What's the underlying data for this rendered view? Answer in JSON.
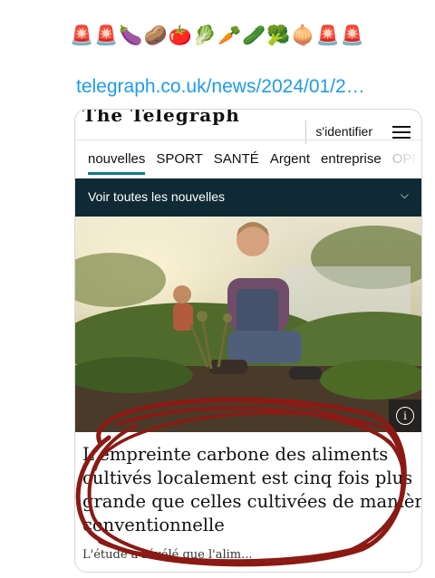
{
  "tweet": {
    "emoji_line": "🚨🚨🍆🥔🍅🥬🥕🥒🥦🧅🚨🚨",
    "link_text": "telegraph.co.uk/news/2024/01/2…"
  },
  "card": {
    "masthead": "The Telegraph",
    "signin_label": "s'identifier",
    "nav_tabs": [
      "nouvelles",
      "SPORT",
      "SANTÉ",
      "Argent",
      "entreprise",
      "OPI"
    ],
    "drawer_label": "Voir toutes les nouvelles",
    "headline_lines": [
      "L'empreinte carbone des aliments",
      "cultivés localement est cinq fois plus",
      "grande que celles cultivées de manièr",
      "conventionnelle"
    ],
    "standfirst": "L'étude a révélé que l'alim..."
  },
  "colors": {
    "link": "#1d9bf0",
    "accent_underline": "#0d7e88",
    "drawer_bg": "#0f2a35",
    "scribble": "#8b1a14"
  },
  "icons": [
    "menu-icon",
    "chevron-down-icon",
    "info-icon"
  ]
}
